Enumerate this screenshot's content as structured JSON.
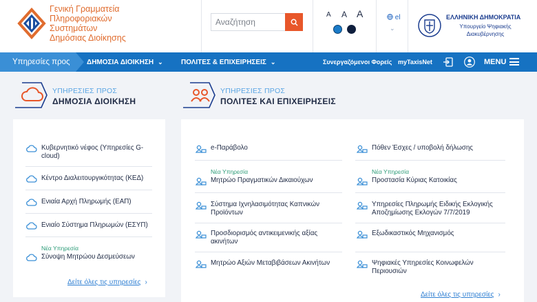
{
  "header": {
    "org_name_lines": [
      "Γενική Γραμματεία",
      "Πληροφοριακών",
      "Συστημάτων",
      "Δημόσιας Διοίκησης"
    ],
    "search": {
      "placeholder": "Αναζήτηση"
    },
    "font_size_labels": [
      "A",
      "A",
      "A"
    ],
    "contrast_colors": [
      "#1a7bc8",
      "#0f1e3d"
    ],
    "language": "el",
    "gov": {
      "title": "ΕΛΛΗΝΙΚΗ ΔΗΜΟΚΡΑΤΙΑ",
      "subtitle": "Υπουργείο Ψηφιακής Διακυβέρνησης"
    }
  },
  "nav": {
    "lead": "Υπηρεσίες προς",
    "tabs": [
      {
        "label": "ΔΗΜΟΣΙΑ ΔΙΟΙΚΗΣΗ"
      },
      {
        "label": "ΠΟΛΙΤΕΣ & ΕΠΙΧΕΙΡΗΣΕΙΣ"
      }
    ],
    "links": [
      "Συνεργαζόμενοι Φορείς",
      "myTaxisNet"
    ],
    "icons": [
      "login-icon",
      "user-icon"
    ],
    "menu_label": "MENU"
  },
  "sections": {
    "public": {
      "small": "ΥΠΗΡΕΣΙΕΣ ΠΡΟΣ",
      "title": "ΔΗΜΟΣΙΑ ΔΙΟΙΚΗΣΗ",
      "icon": "cloud-icon",
      "items": [
        {
          "label": "Κυβερνητικό νέφος (Υπηρεσίες G-cloud)",
          "badge": ""
        },
        {
          "label": "Κέντρο Διαλειτουργικότητας (ΚΕΔ)",
          "badge": ""
        },
        {
          "label": "Ενιαία Αρχή Πληρωμής (ΕΑΠ)",
          "badge": ""
        },
        {
          "label": "Ενιαίο Σύστημα Πληρωμών (ΕΣΥΠ)",
          "badge": ""
        },
        {
          "label": "Σύνοψη Μητρώου Δεσμεύσεων",
          "badge": "Νέα Υπηρεσία"
        }
      ],
      "see_all": "Δείτε όλες τις υπηρεσίες"
    },
    "citizens": {
      "small": "ΥΠΗΡΕΣΙΕΣ ΠΡΟΣ",
      "title": "ΠΟΛΙΤΕΣ ΚΑΙ ΕΠΙΧΕΙΡΗΣΕΙΣ",
      "icon": "people-icon",
      "left_items": [
        {
          "label": "e-Παράβολο",
          "badge": ""
        },
        {
          "label": "Μητρώο Πραγματικών Δικαιούχων",
          "badge": "Νέα Υπηρεσία"
        },
        {
          "label": "Σύστημα Ιχνηλασιμότητας Καπνικών Προϊόντων",
          "badge": ""
        },
        {
          "label": "Προσδιορισμός αντικειμενικής αξίας ακινήτων",
          "badge": ""
        },
        {
          "label": "Μητρώο Αξιών Μεταβιβάσεων Ακινήτων",
          "badge": ""
        }
      ],
      "right_items": [
        {
          "label": "Πόθεν Έσχες / υποβολή δήλωσης",
          "badge": ""
        },
        {
          "label": "Προστασία Κύριας Κατοικίας",
          "badge": "Νέα Υπηρεσία"
        },
        {
          "label": "Υπηρεσίες Πληρωμής Ειδικής Εκλογικής Αποζημίωσης Εκλογών 7/7/2019",
          "badge": ""
        },
        {
          "label": "Εξωδικαστικός Μηχανισμός",
          "badge": ""
        },
        {
          "label": "Ψηφιακές Υπηρεσίες Κοινωφελών Περιουσιών",
          "badge": ""
        }
      ],
      "see_all": "Δείτε όλες τις υπηρεσίες"
    }
  }
}
